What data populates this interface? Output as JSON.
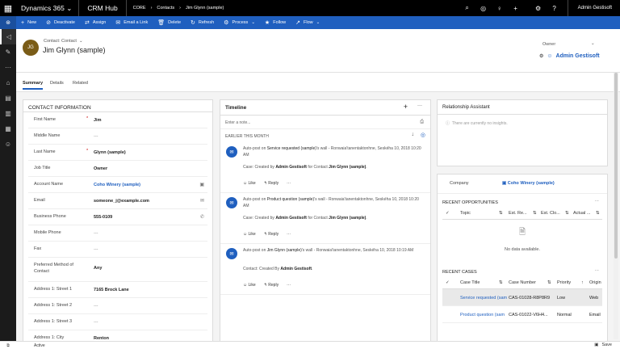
{
  "topbar": {
    "brand": "Dynamics 365",
    "brand_chev": "⌄",
    "app": "CRM Hub",
    "breadcrumb": [
      "CORE",
      "Contacts",
      "Jim Glynn (sample)"
    ],
    "crumb_sep": "›",
    "user": "Admin Gestisoft"
  },
  "commands": [
    {
      "label": "New",
      "icon": "+"
    },
    {
      "label": "Deactivate",
      "icon": "⊘"
    },
    {
      "label": "Assign",
      "icon": "⇄"
    },
    {
      "label": "Email a Link",
      "icon": "✉"
    },
    {
      "label": "Delete",
      "icon": "🗑"
    },
    {
      "label": "Refresh",
      "icon": "↻"
    },
    {
      "label": "Process",
      "icon": "⚙",
      "chev": "⌄"
    },
    {
      "label": "Follow",
      "icon": "★"
    },
    {
      "label": "Flow",
      "icon": "↗",
      "chev": "⌄"
    }
  ],
  "header": {
    "initials": "JG",
    "entity_type": "Contact: Contact",
    "entity_chev": "⌄",
    "name": "Jim Glynn (sample)",
    "owner_label": "Owner",
    "owner_value": "Admin Gestisoft"
  },
  "tabs": [
    "Summary",
    "Details",
    "Related"
  ],
  "contact_info": {
    "title": "CONTACT INFORMATION",
    "fields": [
      {
        "label": "First Name",
        "value": "Jim",
        "req": "*",
        "style": "b"
      },
      {
        "label": "Middle Name",
        "value": "---",
        "style": "dash"
      },
      {
        "label": "Last Name",
        "value": "Glynn (sample)",
        "req": "*",
        "style": "b"
      },
      {
        "label": "Job Title",
        "value": "Owner",
        "style": "b"
      },
      {
        "label": "Account Name",
        "value": "Coho Winery (sample)",
        "style": "link",
        "icon": "▣"
      },
      {
        "label": "Email",
        "value": "someone_j@example.com",
        "style": "b",
        "icon": "✉"
      },
      {
        "label": "Business Phone",
        "value": "555-0109",
        "style": "b",
        "icon": "✆"
      },
      {
        "label": "Mobile Phone",
        "value": "---",
        "style": "dash"
      },
      {
        "label": "Fax",
        "value": "---",
        "style": "dash"
      },
      {
        "label": "Preferred Method of Contact",
        "value": "Any",
        "style": "b"
      },
      {
        "label": "Address 1: Street 1",
        "value": "7165 Brock Lane",
        "style": "b"
      },
      {
        "label": "Address 1: Street 2",
        "value": "---",
        "style": "dash"
      },
      {
        "label": "Address 1: Street 3",
        "value": "---",
        "style": "dash"
      },
      {
        "label": "Address 1: City",
        "value": "Renton",
        "style": "b"
      }
    ]
  },
  "timeline": {
    "title": "Timeline",
    "note_placeholder": "Enter a note...",
    "section": "EARLIER THIS MONTH",
    "posts": [
      {
        "pre": "Auto-post on ",
        "subject": "Service requested (sample)",
        "post": "'s wall - ",
        "meta": "Ronwaia'tanentaktonhne, Seskéha 10, 2018 10:20 AM",
        "line_pre": "Case: Created by ",
        "line_user": "Admin Gestisoft",
        "line_post": " for Contact ",
        "line_obj": "Jim Glynn (sample)",
        "line_end": "."
      },
      {
        "pre": "Auto-post on ",
        "subject": "Product question (sample)",
        "post": "'s wall - ",
        "meta": "Ronwaia'tanentaktonhne, Seskéha 10, 2018 10:20 AM",
        "line_pre": "Case: Created by ",
        "line_user": "Admin Gestisoft",
        "line_post": " for Contact ",
        "line_obj": "Jim Glynn (sample)",
        "line_end": "."
      },
      {
        "pre": "Auto-post on ",
        "subject": "Jim Glynn (sample)",
        "post": "'s wall - ",
        "meta": "Ronwaia'tanentaktonhne, Seskéha 10, 2018 10:19 AM",
        "line_pre": "Contact: Created By ",
        "line_user": "Admin Gestisoft",
        "line_post": "",
        "line_obj": "",
        "line_end": "."
      }
    ],
    "like": "Like",
    "reply": "Reply",
    "more": "···"
  },
  "relationship_assistant": {
    "title": "Relationship Assistant",
    "empty": "There are currently no insights."
  },
  "related": {
    "company_label": "Company",
    "company_value": "Coho Winery (sample)",
    "opportunities": {
      "title": "RECENT OPPORTUNITIES",
      "cols": [
        "Topic",
        "Est. Re...",
        "Est. Clo...",
        "Actual ..."
      ],
      "empty": "No data available."
    },
    "cases": {
      "title": "RECENT CASES",
      "cols": [
        "Case Title",
        "Case Number",
        "Priority",
        "Origin"
      ],
      "rows": [
        {
          "title": "Service requested (sam",
          "number": "CAS-01028-R8P8R9",
          "priority": "Low",
          "origin": "Web"
        },
        {
          "title": "Product question (sam",
          "number": "CAS-01022-V6H4...",
          "priority": "Normal",
          "origin": "Email"
        }
      ]
    }
  },
  "status": {
    "state": "Active",
    "save": "Save"
  }
}
